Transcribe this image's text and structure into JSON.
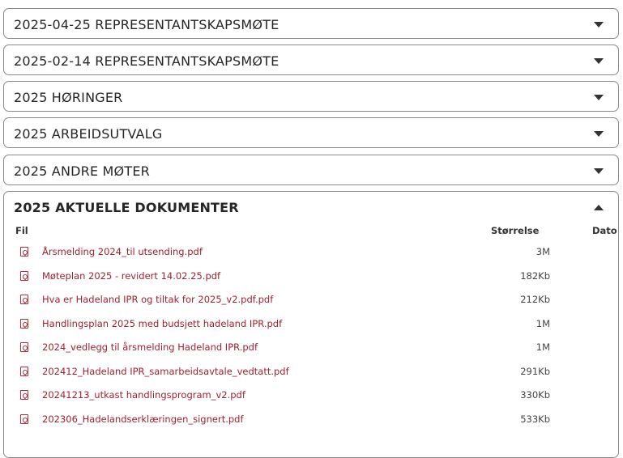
{
  "sections": [
    {
      "title": "2025-04-25 REPRESENTANTSKAPSMØTE",
      "caret": "chevron-down"
    },
    {
      "title": "2025-02-14 REPRESENTANTSKAPSMØTE",
      "caret": "chevron-down"
    },
    {
      "title": "2025 HØRINGER",
      "caret": "chevron-down"
    },
    {
      "title": "2025 ARBEIDSUTVALG",
      "caret": "chevron-down"
    },
    {
      "title": "2025 ANDRE MØTER",
      "caret": "chevron-down"
    }
  ],
  "open_section": {
    "title": "2025 AKTUELLE DOKUMENTER",
    "caret": "chevron-up",
    "columns": {
      "file": "Fil",
      "size": "Størrelse",
      "date": "Dato"
    },
    "files": [
      {
        "name": "Årsmelding 2024_til utsending.pdf",
        "size": "3M",
        "icon": "pdf-icon"
      },
      {
        "name": "Møteplan 2025 - revidert 14.02.25.pdf",
        "size": "182Kb",
        "icon": "pdf-icon"
      },
      {
        "name": "Hva er Hadeland IPR og tiltak for 2025_v2.pdf.pdf",
        "size": "212Kb",
        "icon": "pdf-icon"
      },
      {
        "name": "Handlingsplan 2025 med budsjett hadeland IPR.pdf",
        "size": "1M",
        "icon": "pdf-icon"
      },
      {
        "name": "2024_vedlegg til årsmelding Hadeland IPR.pdf",
        "size": "1M",
        "icon": "pdf-icon"
      },
      {
        "name": "202412_Hadeland IPR_samarbeidsavtale_vedtatt.pdf",
        "size": "291Kb",
        "icon": "pdf-icon"
      },
      {
        "name": "20241213_utkast handlingsprogram_v2.pdf",
        "size": "330Kb",
        "icon": "pdf-icon"
      },
      {
        "name": "202306_Hadelandserklæringen_signert.pdf",
        "size": "533Kb",
        "icon": "pdf-icon"
      }
    ]
  },
  "colors": {
    "link": "#a0222f",
    "border": "#8a8a8a",
    "text": "#262626"
  }
}
